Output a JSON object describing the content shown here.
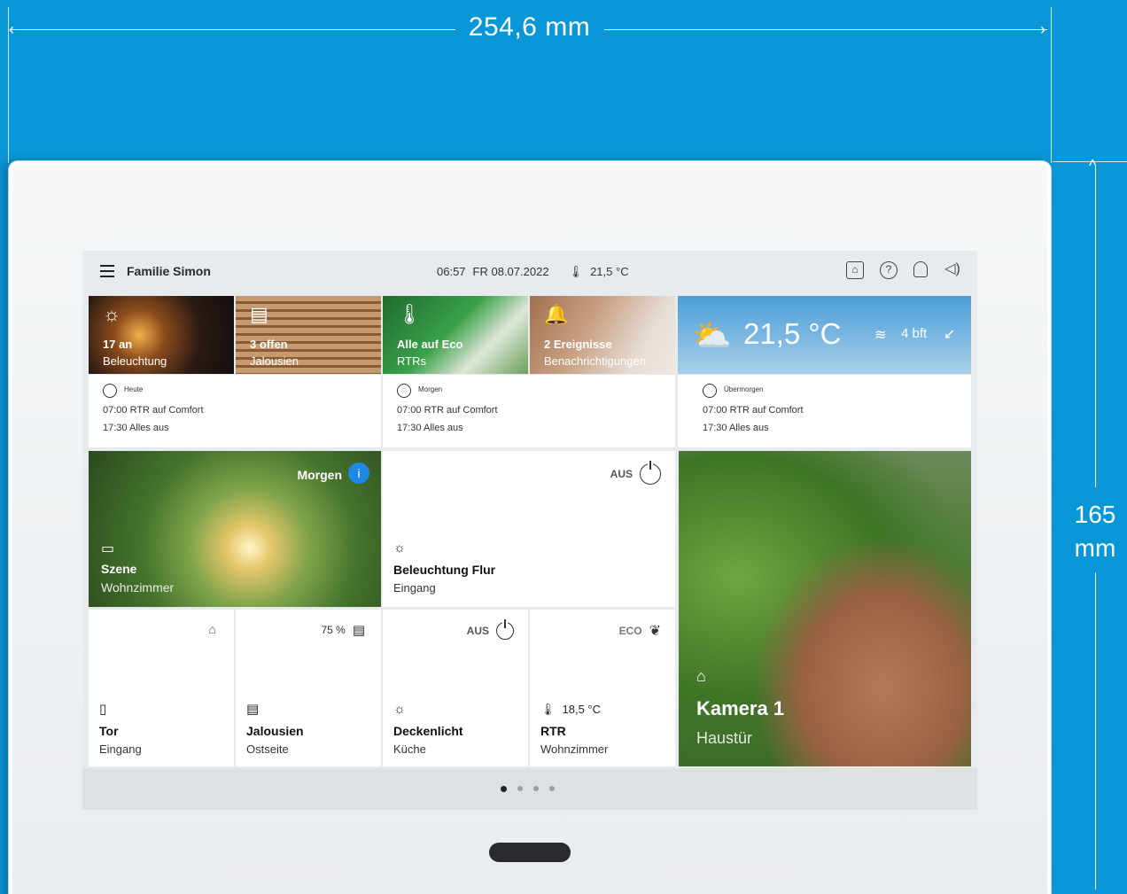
{
  "annotation": {
    "width_label": "254,6 mm",
    "height_value": "165",
    "height_unit": "mm"
  },
  "colors": {
    "background": "#0a97d8",
    "panel_frame": "#f4f6f7",
    "screen_bg": "#e8ebed"
  },
  "topbar": {
    "menu_icon": "hamburger-icon",
    "title": "Familie Simon",
    "time": "06:57",
    "date": "FR 08.07.2022",
    "temperature": "21,5 °C",
    "icons": [
      "lock-icon",
      "help-icon",
      "bell-icon",
      "speaker-icon"
    ]
  },
  "photo_tiles": [
    {
      "line1": "17 an",
      "line2": "Beleuchtung",
      "icon": "bulb-icon"
    },
    {
      "line1": "3 offen",
      "line2": "Jalousien",
      "icon": "blind-icon"
    },
    {
      "line1": "Alle auf Eco",
      "line2": "RTRs",
      "icon": "thermometer-icon"
    },
    {
      "line1": "2 Ereignisse",
      "line2": "Benachrichtigungen",
      "icon": "bell-icon"
    }
  ],
  "weather": {
    "temperature": "21,5 °C",
    "wind": "4 bft",
    "icon": "partly-cloudy-icon"
  },
  "schedules": [
    {
      "day": "Heute",
      "row1": "07:00 RTR auf Comfort",
      "row2": "17:30 Alles aus"
    },
    {
      "day": "Morgen",
      "row1": "07:00 RTR auf Comfort",
      "row2": "17:30 Alles aus"
    },
    {
      "day": "Übermorgen",
      "row1": "07:00 RTR auf Comfort",
      "row2": "17:30 Alles aus"
    }
  ],
  "scene": {
    "badge": "Morgen",
    "title": "Szene",
    "subtitle": "Wohnzimmer"
  },
  "flur": {
    "status": "AUS",
    "title": "Beleuchtung Flur",
    "subtitle": "Eingang"
  },
  "camera": {
    "title": "Kamera 1",
    "subtitle": "Haustür"
  },
  "small_tiles": [
    {
      "status": "",
      "status_icon": "lock-icon",
      "title": "Tor",
      "subtitle": "Eingang",
      "icon": "door-icon"
    },
    {
      "status": "75 %",
      "status_icon": "blind-icon",
      "title": "Jalousien",
      "subtitle": "Ostseite",
      "icon": "blind-icon"
    },
    {
      "status": "AUS",
      "status_icon": "power-icon",
      "title": "Deckenlicht",
      "subtitle": "Küche",
      "icon": "bulb-icon"
    },
    {
      "status": "ECO",
      "status_icon": "leaf-icon",
      "reading": "18,5 °C",
      "title": "RTR",
      "subtitle": "Wohnzimmer",
      "icon": "thermometer-icon"
    }
  ],
  "pager": {
    "pages": 4,
    "current": 1
  }
}
